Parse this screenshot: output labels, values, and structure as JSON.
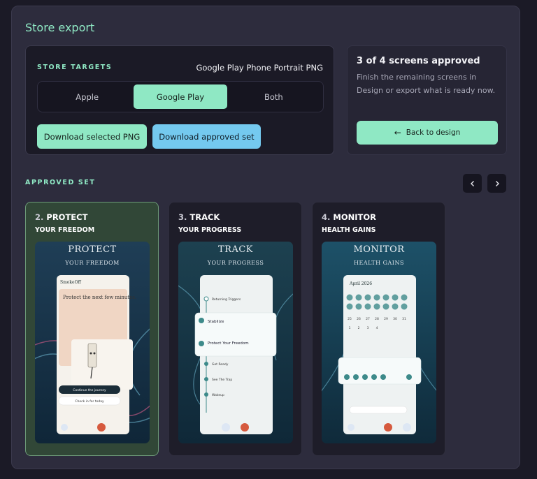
{
  "page": {
    "title": "Store export"
  },
  "targets": {
    "label": "STORE TARGETS",
    "format": "Google Play Phone Portrait PNG",
    "options": [
      "Apple",
      "Google Play",
      "Both"
    ],
    "selected": "Google Play",
    "download_selected": "Download selected PNG",
    "download_approved": "Download approved set"
  },
  "approval": {
    "heading": "3 of 4 screens approved",
    "message": "Finish the remaining screens in Design or export what is ready now.",
    "back_label": "Back to design"
  },
  "approved_set": {
    "label": "APPROVED SET",
    "cards": [
      {
        "num": "2.",
        "title": "PROTECT",
        "subtitle": "YOUR FREEDOM",
        "shot_title": "PROTECT",
        "shot_sub": "YOUR FREEDOM",
        "selected": true
      },
      {
        "num": "3.",
        "title": "TRACK",
        "subtitle": "YOUR PROGRESS",
        "shot_title": "TRACK",
        "shot_sub": "YOUR PROGRESS",
        "selected": false
      },
      {
        "num": "4.",
        "title": "MONITOR",
        "subtitle": "HEALTH GAINS",
        "shot_title": "MONITOR",
        "shot_sub": "HEALTH GAINS",
        "selected": false
      }
    ]
  },
  "protect_shot": {
    "app": "SmokeOff",
    "head": "Protect the next few minutes.",
    "cta": "Continue the journey",
    "cta2": "Check in for today"
  },
  "track_shot": {
    "items": [
      "Returning Triggers",
      "Stabilize",
      "Protect Your Freedom",
      "Get Ready",
      "See The Trap",
      "Wakeup"
    ]
  },
  "monitor_shot": {
    "month": "April 2026",
    "calendar": [
      "25",
      "26",
      "27",
      "28",
      "29",
      "30",
      "31",
      "1",
      "2",
      "3",
      "4"
    ]
  },
  "colors": {
    "accent": "#8fe8c4",
    "secondary": "#74c9ef",
    "panel": "#2d2c3d"
  }
}
